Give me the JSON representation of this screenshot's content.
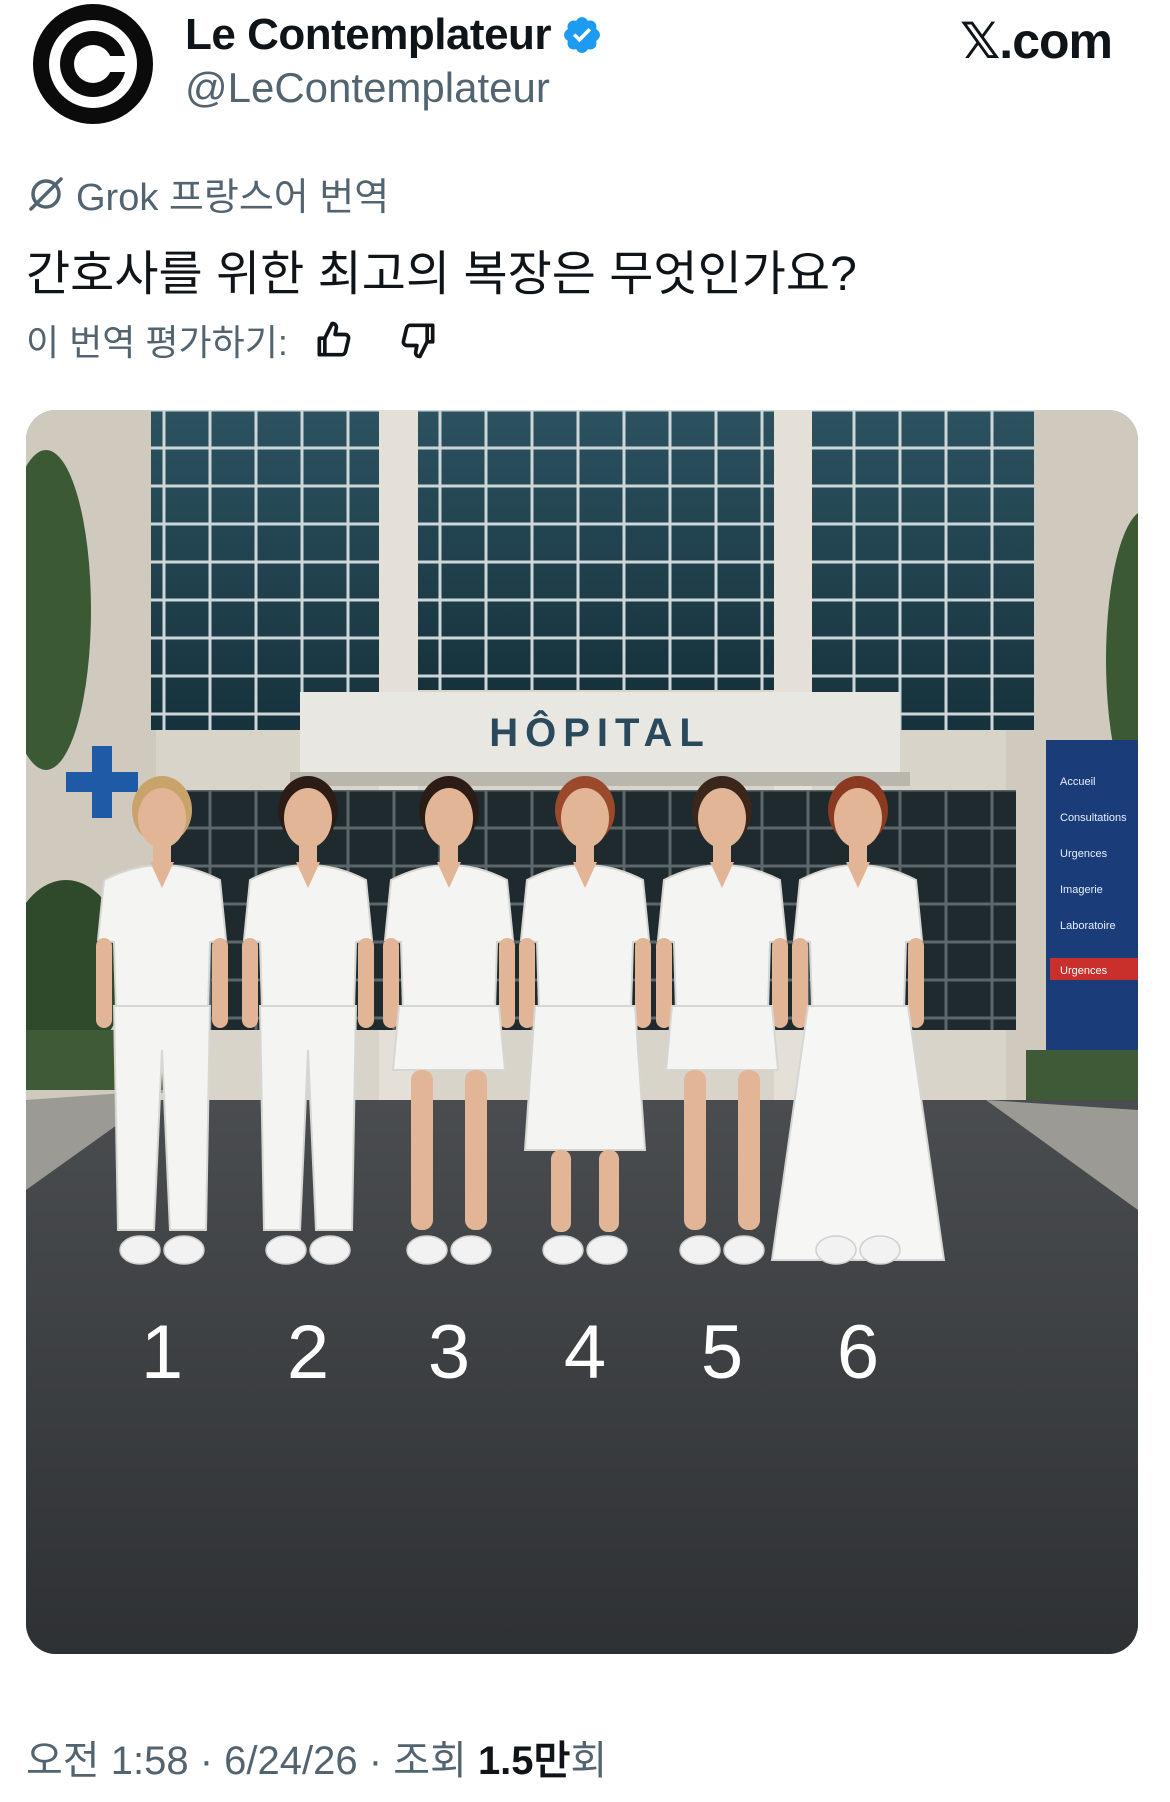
{
  "account": {
    "name": "Le Contemplateur",
    "handle": "@LeContemplateur",
    "avatar_icon": "copyright-style-c-logo",
    "verified_icon": "verified-badge-icon",
    "verified_color": "#1d9bf0"
  },
  "brand": "𝕏.com",
  "translation": {
    "label": "Grok 프랑스어 번역",
    "icon": "grok-icon"
  },
  "tweet_text": "간호사를 위한 최고의 복장은 무엇인가요?",
  "rating": {
    "label": "이 번역 평가하기:",
    "up_icon": "thumbs-up-icon",
    "down_icon": "thumbs-down-icon"
  },
  "image": {
    "sign": "HÔPITAL",
    "directory": [
      "Accueil",
      "Consultations",
      "Urgences",
      "Imagerie",
      "Laboratoire"
    ],
    "directory_exit": "Urgences",
    "numbers": [
      "1",
      "2",
      "3",
      "4",
      "5",
      "6"
    ]
  },
  "meta": {
    "time": "오전 1:58",
    "sep": "·",
    "date": "6/24/26",
    "views_prefix": "조회",
    "views_value": "1.5만",
    "views_suffix": "회"
  }
}
